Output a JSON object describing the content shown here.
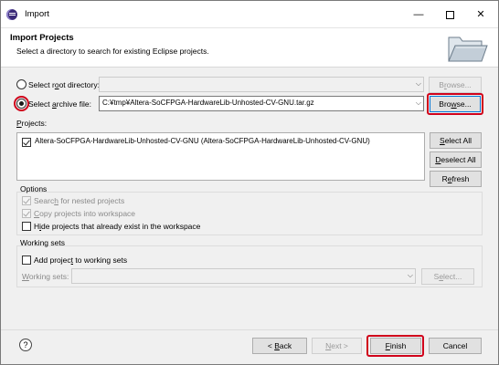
{
  "window": {
    "title": "Import"
  },
  "window_controls": {
    "minimize": "—",
    "close": "✕"
  },
  "header": {
    "title": "Import Projects",
    "description": "Select a directory to search for existing Eclipse projects."
  },
  "source": {
    "root_directory_label": "Select root directory:",
    "root_directory_value": "",
    "root_browse_label": "Browse...",
    "archive_file_label": "Select archive file:",
    "archive_file_value": "C:¥tmp¥Altera-SoCFPGA-HardwareLib-Unhosted-CV-GNU.tar.gz",
    "archive_browse_label": "Browse...",
    "selected": "archive"
  },
  "projects": {
    "label": "Projects:",
    "items": [
      {
        "label": "Altera-SoCFPGA-HardwareLib-Unhosted-CV-GNU (Altera-SoCFPGA-HardwareLib-Unhosted-CV-GNU)",
        "checked": true
      }
    ],
    "select_all_label": "Select All",
    "deselect_all_label": "Deselect All",
    "refresh_label": "Refresh"
  },
  "options": {
    "title": "Options",
    "search_nested_label": "Search for nested projects",
    "copy_projects_label": "Copy projects into workspace",
    "hide_existing_label": "Hide projects that already exist in the workspace"
  },
  "working_sets": {
    "title": "Working sets",
    "add_label": "Add project to working sets",
    "sets_label": "Working sets:",
    "sets_value": "",
    "select_label": "Select..."
  },
  "footer": {
    "help": "?",
    "back_label": "< Back",
    "next_label": "Next >",
    "finish_label": "Finish",
    "cancel_label": "Cancel"
  },
  "colors": {
    "highlight": "#d0021b",
    "focus": "#0078d7"
  }
}
